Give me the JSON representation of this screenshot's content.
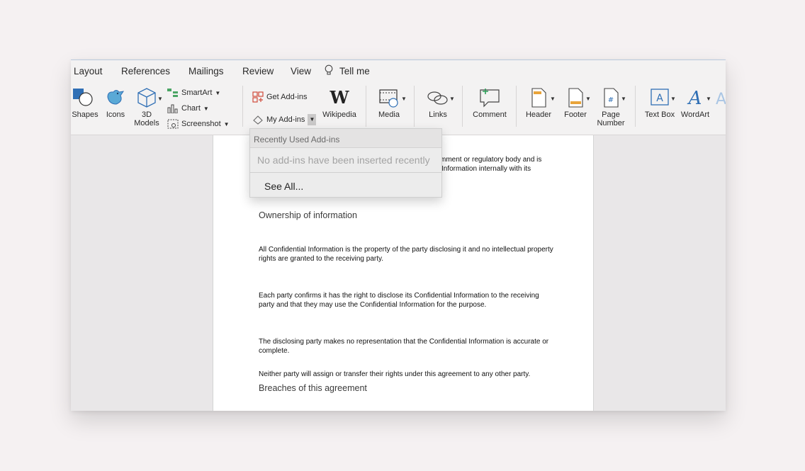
{
  "tabs": [
    "Layout",
    "References",
    "Mailings",
    "Review",
    "View"
  ],
  "tell_me": "Tell me",
  "ribbon": {
    "shapes": "Shapes",
    "icons": "Icons",
    "models_line1": "3D",
    "models_line2": "Models",
    "smartart": "SmartArt",
    "chart": "Chart",
    "screenshot": "Screenshot",
    "get_addins": "Get Add-ins",
    "my_addins": "My Add-ins",
    "wikipedia": "Wikipedia",
    "media": "Media",
    "links": "Links",
    "comment": "Comment",
    "header": "Header",
    "footer": "Footer",
    "page_number_line1": "Page",
    "page_number_line2": "Number",
    "text_box": "Text Box",
    "wordart": "WordArt"
  },
  "dropdown": {
    "section_title": "Recently Used Add-ins",
    "empty_message": "No add-ins have been inserted recently",
    "see_all": "See All..."
  },
  "document": {
    "partial_line1": "mment or regulatory body and is",
    "partial_line2": "Information internally with its",
    "heading1": "Ownership of information",
    "para1": "All Confidential Information is the property of the party disclosing it and no intellectual property rights are granted to the receiving party.",
    "para2": "Each party confirms it has the right to disclose its Confidential Information to the receiving party and that they may use the Confidential Information for the purpose.",
    "para3": "The disclosing party makes no representation that the Confidential Information is accurate or complete.",
    "para4": "Neither party will assign or transfer their rights under this agreement to any other party.",
    "heading2": "Breaches of this agreement"
  },
  "colors": {
    "accent_blue": "#2f6fb5",
    "addin_red": "#d04a3a"
  }
}
